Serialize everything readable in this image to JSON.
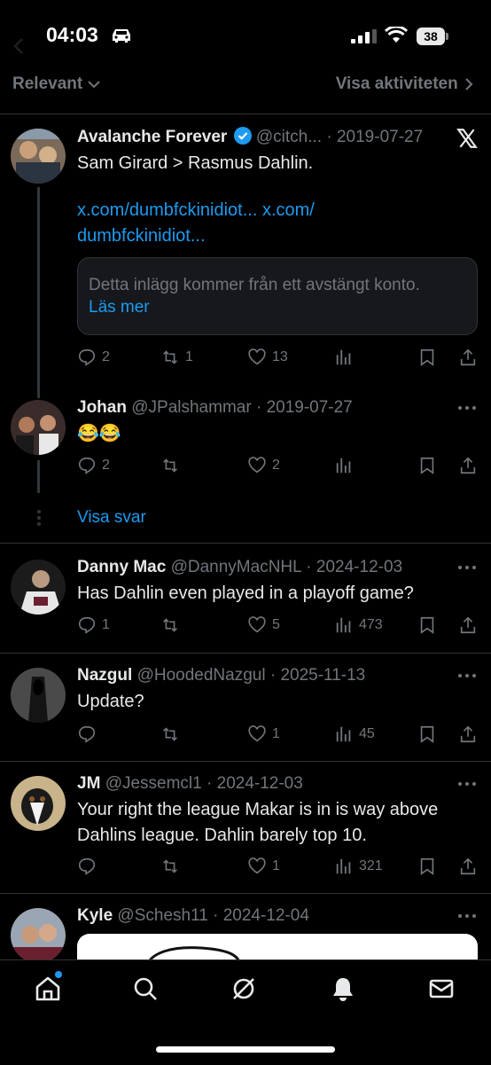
{
  "status_bar": {
    "time": "04:03",
    "battery": "38"
  },
  "filter": {
    "sort_label": "Relevant",
    "activity_label": "Visa aktiviteten"
  },
  "tweets": [
    {
      "name": "Avalanche Forever",
      "handle": "@citch...",
      "date": "2019-07-27",
      "text": "Sam Girard > Rasmus Dahlin.",
      "links": "x.com/dumbfckinidiot... x.com/ dumbfckinidiot...",
      "quote_notice": "Detta inlägg kommer från ett avstängt konto.",
      "quote_link": "Läs mer",
      "replies": "2",
      "reposts": "1",
      "likes": "13",
      "views": ""
    },
    {
      "name": "Johan",
      "handle": "@JPalshammar",
      "date": "2019-07-27",
      "text": "😂😂",
      "replies": "2",
      "reposts": "",
      "likes": "2",
      "views": ""
    },
    {
      "name": "Danny Mac",
      "handle": "@DannyMacNHL",
      "date": "2024-12-03",
      "text": "Has Dahlin even played in a playoff game?",
      "replies": "1",
      "reposts": "",
      "likes": "5",
      "views": "473"
    },
    {
      "name": "Nazgul",
      "handle": "@HoodedNazgul",
      "date": "2025-11-13",
      "text": "Update?",
      "replies": "",
      "reposts": "",
      "likes": "1",
      "views": "45"
    },
    {
      "name": "JM",
      "handle": "@Jessemcl1",
      "date": "2024-12-03",
      "text": "Your right the league Makar is in is way above Dahlins league. Dahlin barely top 10.",
      "replies": "",
      "reposts": "",
      "likes": "1",
      "views": "321"
    },
    {
      "name": "Kyle",
      "handle": "@Schesh11",
      "date": "2024-12-04"
    }
  ],
  "show_replies": "Visa svar",
  "separator": "·",
  "colors": {
    "background": "#000000",
    "accent": "#1d9bf0",
    "muted": "#71767b",
    "text": "#e7e9ea"
  }
}
